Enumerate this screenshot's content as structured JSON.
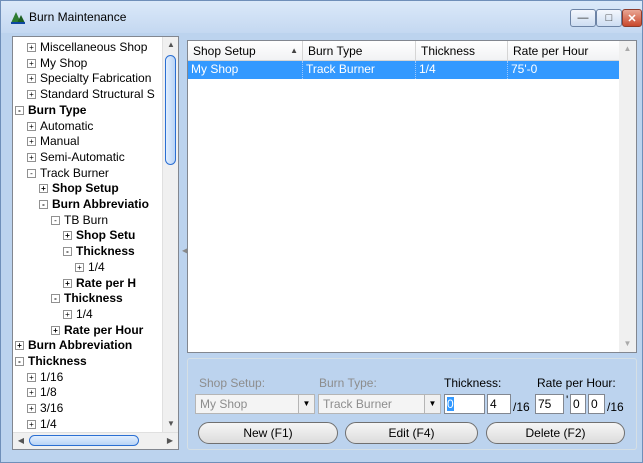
{
  "window": {
    "title": "Burn Maintenance",
    "minimize_icon": "minimize-icon",
    "maximize_icon": "maximize-icon",
    "close_icon": "close-icon"
  },
  "tree": {
    "nodes": [
      {
        "label": "Miscellaneous Shop",
        "bold": false,
        "expander": "+"
      },
      {
        "label": "My Shop",
        "bold": false,
        "expander": "+"
      },
      {
        "label": "Specialty Fabrication",
        "bold": false,
        "expander": "+"
      },
      {
        "label": "Standard Structural S",
        "bold": false,
        "expander": "+"
      },
      {
        "label": "Burn Type",
        "bold": true,
        "expander": "-"
      },
      {
        "label": "Automatic",
        "bold": false,
        "expander": "+"
      },
      {
        "label": "Manual",
        "bold": false,
        "expander": "+"
      },
      {
        "label": "Semi-Automatic",
        "bold": false,
        "expander": "+"
      },
      {
        "label": "Track Burner",
        "bold": false,
        "expander": "-"
      },
      {
        "label": "Shop Setup",
        "bold": true,
        "expander": "+"
      },
      {
        "label": "Burn Abbreviatio",
        "bold": true,
        "expander": "-"
      },
      {
        "label": "TB Burn",
        "bold": false,
        "expander": "-"
      },
      {
        "label": "Shop Setu",
        "bold": true,
        "expander": "+"
      },
      {
        "label": "Thickness",
        "bold": true,
        "expander": "-"
      },
      {
        "label": "1/4",
        "bold": false,
        "expander": "+"
      },
      {
        "label": "Rate per H",
        "bold": true,
        "expander": "+"
      },
      {
        "label": "Thickness",
        "bold": true,
        "expander": "-"
      },
      {
        "label": "1/4",
        "bold": false,
        "expander": "+"
      },
      {
        "label": "Rate per Hour",
        "bold": true,
        "expander": "+"
      },
      {
        "label": "Burn Abbreviation",
        "bold": true,
        "expander": "+"
      },
      {
        "label": "Thickness",
        "bold": true,
        "expander": "-"
      },
      {
        "label": "1/16",
        "bold": false,
        "expander": "+"
      },
      {
        "label": "1/8",
        "bold": false,
        "expander": "+"
      },
      {
        "label": "3/16",
        "bold": false,
        "expander": "+"
      },
      {
        "label": "1/4",
        "bold": false,
        "expander": "+"
      }
    ]
  },
  "grid": {
    "columns": [
      "Shop Setup",
      "Burn Type",
      "Thickness",
      "Rate per Hour"
    ],
    "rows": [
      [
        "My Shop",
        "Track Burner",
        "1/4",
        "75'-0"
      ]
    ]
  },
  "form": {
    "shop_setup_label": "Shop Setup:",
    "shop_setup_value": "My Shop",
    "burn_type_label": "Burn Type:",
    "burn_type_value": "Track Burner",
    "thickness_label": "Thickness:",
    "thickness_whole": "0",
    "thickness_num": "4",
    "thickness_denom": "/16",
    "rate_label": "Rate per Hour:",
    "rate_feet": "75",
    "rate_feet_mark": "'",
    "rate_inches": "0",
    "rate_frac": "0",
    "rate_denom": "/16"
  },
  "buttons": {
    "new": "New (F1)",
    "edit": "Edit (F4)",
    "delete": "Delete (F2)"
  },
  "colors": {
    "selection": "#3399ff",
    "title_bg": "#c4d8f1"
  }
}
